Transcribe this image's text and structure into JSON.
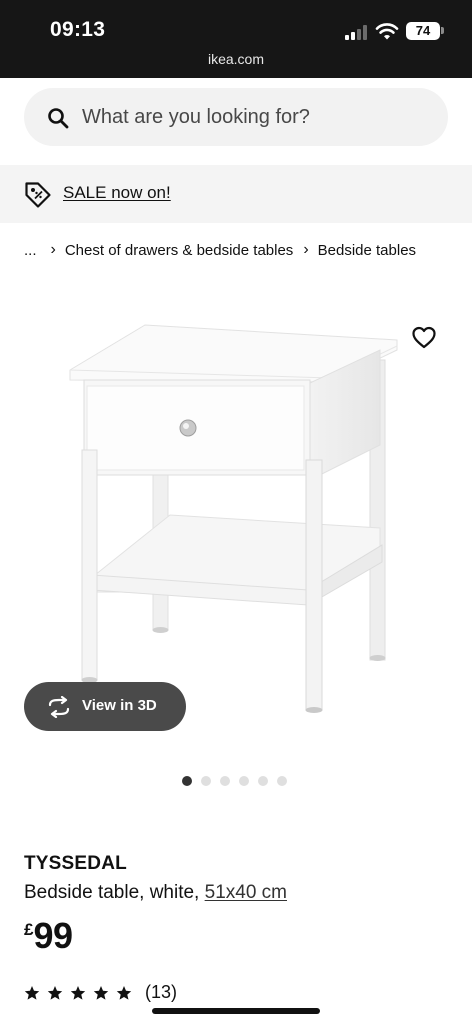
{
  "status_bar": {
    "time": "09:13",
    "url": "ikea.com",
    "battery": "74"
  },
  "search": {
    "placeholder": "What are you looking for?"
  },
  "sale_banner": {
    "label": "SALE now on!"
  },
  "breadcrumb": {
    "ellipsis": "...",
    "items": [
      "Chest of drawers & bedside tables",
      "Bedside tables"
    ],
    "separator": "›"
  },
  "gallery": {
    "view_3d_label": "View in 3D",
    "image_count": 6,
    "active_index": 0
  },
  "product": {
    "name": "TYSSEDAL",
    "description": "Bedside table, white,",
    "dimensions": "51x40 cm",
    "currency": "£",
    "price": "99",
    "rating": 5,
    "rating_max": 5,
    "review_count": "(13)"
  },
  "colors": {
    "status_bar_bg": "#161616",
    "search_bg": "#f2f2f2",
    "banner_bg": "#f4f4f4",
    "view3d_bg": "#4a4a4a"
  }
}
